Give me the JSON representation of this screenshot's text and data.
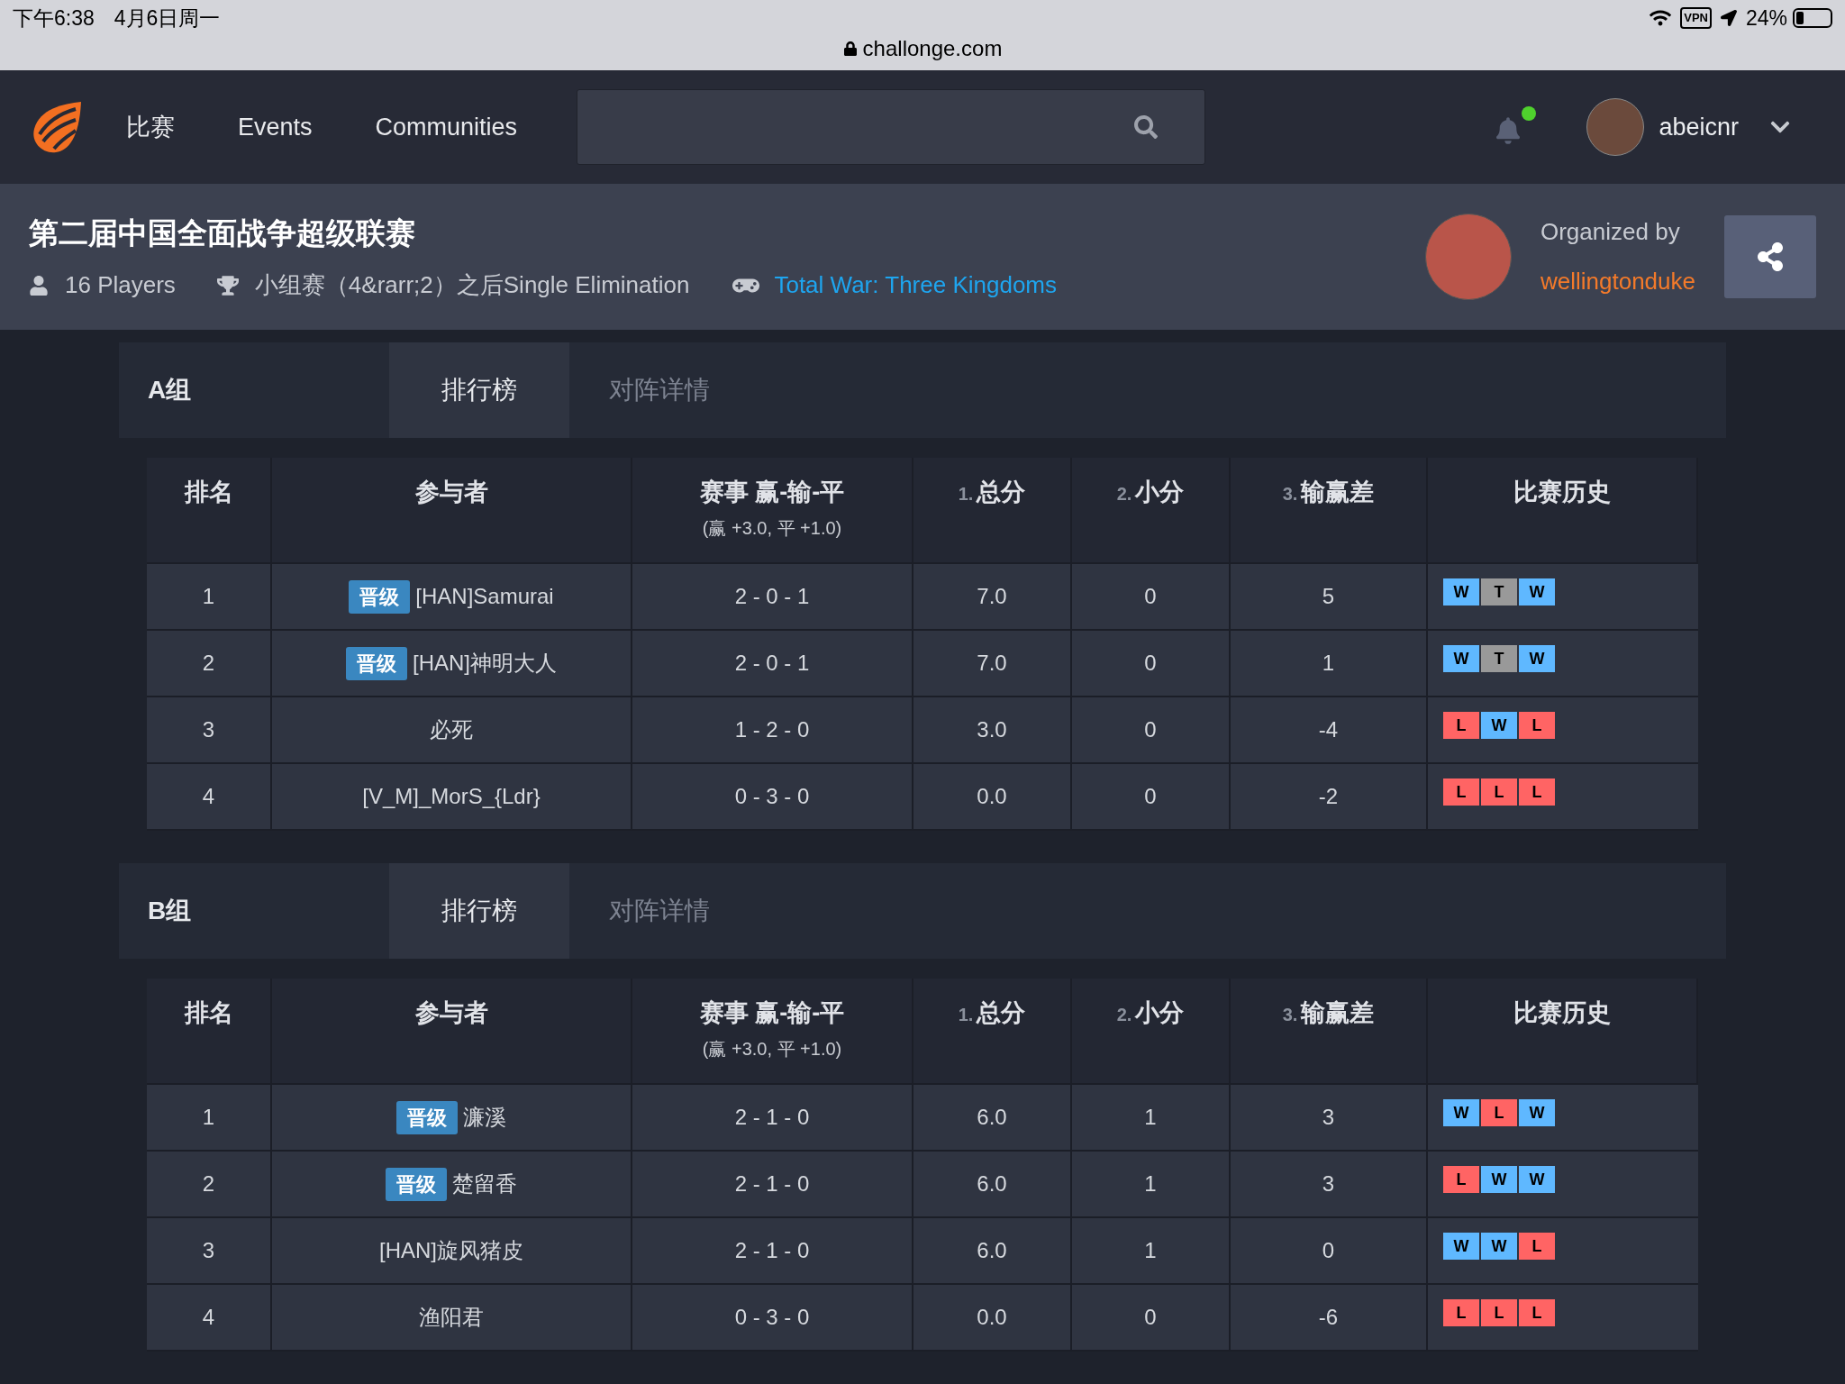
{
  "status_bar": {
    "time": "下午6:38",
    "date": "4月6日周一",
    "url": "challonge.com",
    "vpn": "VPN",
    "battery": "24%"
  },
  "nav": {
    "links": [
      "比赛",
      "Events",
      "Communities"
    ],
    "notifications": {
      "unread": true
    },
    "user": "abeicnr"
  },
  "tournament": {
    "title": "第二届中国全面战争超级联赛",
    "players": "16 Players",
    "format": "小组赛（4&rarr;2）之后Single Elimination",
    "game": "Total War: Three Kingdoms",
    "organized_by": "Organized by",
    "organizer": "wellingtonduke"
  },
  "groups": [
    {
      "name": "A组",
      "tabs": [
        {
          "label": "排行榜",
          "selected": true
        },
        {
          "label": "对阵详情",
          "selected": false
        }
      ],
      "columns": [
        {
          "label": "排名"
        },
        {
          "label": "参与者"
        },
        {
          "label": "赛事 赢-输-平",
          "sub": "(赢 +3.0, 平 +1.0)"
        },
        {
          "number": "1.",
          "label": "总分"
        },
        {
          "number": "2.",
          "label": "小分"
        },
        {
          "number": "3.",
          "label": "输赢差"
        },
        {
          "label": "比赛历史"
        }
      ],
      "rows": [
        {
          "rank": "1",
          "badge": "晋级",
          "name": "[HAN]Samurai",
          "record": "2 - 0 - 1",
          "total": "7.0",
          "minor": "0",
          "diff": "5",
          "history": [
            {
              "label": "W",
              "kind": "win"
            },
            {
              "label": "T",
              "kind": "tie"
            },
            {
              "label": "W",
              "kind": "win"
            }
          ]
        },
        {
          "rank": "2",
          "badge": "晋级",
          "name": "[HAN]神明大人",
          "record": "2 - 0 - 1",
          "total": "7.0",
          "minor": "0",
          "diff": "1",
          "history": [
            {
              "label": "W",
              "kind": "win"
            },
            {
              "label": "T",
              "kind": "tie"
            },
            {
              "label": "W",
              "kind": "win"
            }
          ]
        },
        {
          "rank": "3",
          "name": "必死",
          "record": "1 - 2 - 0",
          "total": "3.0",
          "minor": "0",
          "diff": "-4",
          "history": [
            {
              "label": "L",
              "kind": "loss"
            },
            {
              "label": "W",
              "kind": "win"
            },
            {
              "label": "L",
              "kind": "loss"
            }
          ]
        },
        {
          "rank": "4",
          "name": "[V_M]_MorS_{Ldr}",
          "record": "0 - 3 - 0",
          "total": "0.0",
          "minor": "0",
          "diff": "-2",
          "history": [
            {
              "label": "L",
              "kind": "loss"
            },
            {
              "label": "L",
              "kind": "loss"
            },
            {
              "label": "L",
              "kind": "loss"
            }
          ]
        }
      ]
    },
    {
      "name": "B组",
      "tabs": [
        {
          "label": "排行榜",
          "selected": true
        },
        {
          "label": "对阵详情",
          "selected": false
        }
      ],
      "columns": [
        {
          "label": "排名"
        },
        {
          "label": "参与者"
        },
        {
          "label": "赛事 赢-输-平",
          "sub": "(赢 +3.0, 平 +1.0)"
        },
        {
          "number": "1.",
          "label": "总分"
        },
        {
          "number": "2.",
          "label": "小分"
        },
        {
          "number": "3.",
          "label": "输赢差"
        },
        {
          "label": "比赛历史"
        }
      ],
      "rows": [
        {
          "rank": "1",
          "badge": "晋级",
          "name": "濂溪",
          "record": "2 - 1 - 0",
          "total": "6.0",
          "minor": "1",
          "diff": "3",
          "history": [
            {
              "label": "W",
              "kind": "win"
            },
            {
              "label": "L",
              "kind": "loss"
            },
            {
              "label": "W",
              "kind": "win"
            }
          ]
        },
        {
          "rank": "2",
          "badge": "晋级",
          "name": "楚留香",
          "record": "2 - 1 - 0",
          "total": "6.0",
          "minor": "1",
          "diff": "3",
          "history": [
            {
              "label": "L",
              "kind": "loss"
            },
            {
              "label": "W",
              "kind": "win"
            },
            {
              "label": "W",
              "kind": "win"
            }
          ]
        },
        {
          "rank": "3",
          "name": "[HAN]旋风猪皮",
          "record": "2 - 1 - 0",
          "total": "6.0",
          "minor": "1",
          "diff": "0",
          "history": [
            {
              "label": "W",
              "kind": "win"
            },
            {
              "label": "W",
              "kind": "win"
            },
            {
              "label": "L",
              "kind": "loss"
            }
          ]
        },
        {
          "rank": "4",
          "name": "渔阳君",
          "record": "0 - 3 - 0",
          "total": "0.0",
          "minor": "0",
          "diff": "-6",
          "history": [
            {
              "label": "L",
              "kind": "loss"
            },
            {
              "label": "L",
              "kind": "loss"
            },
            {
              "label": "L",
              "kind": "loss"
            }
          ]
        }
      ]
    }
  ]
}
